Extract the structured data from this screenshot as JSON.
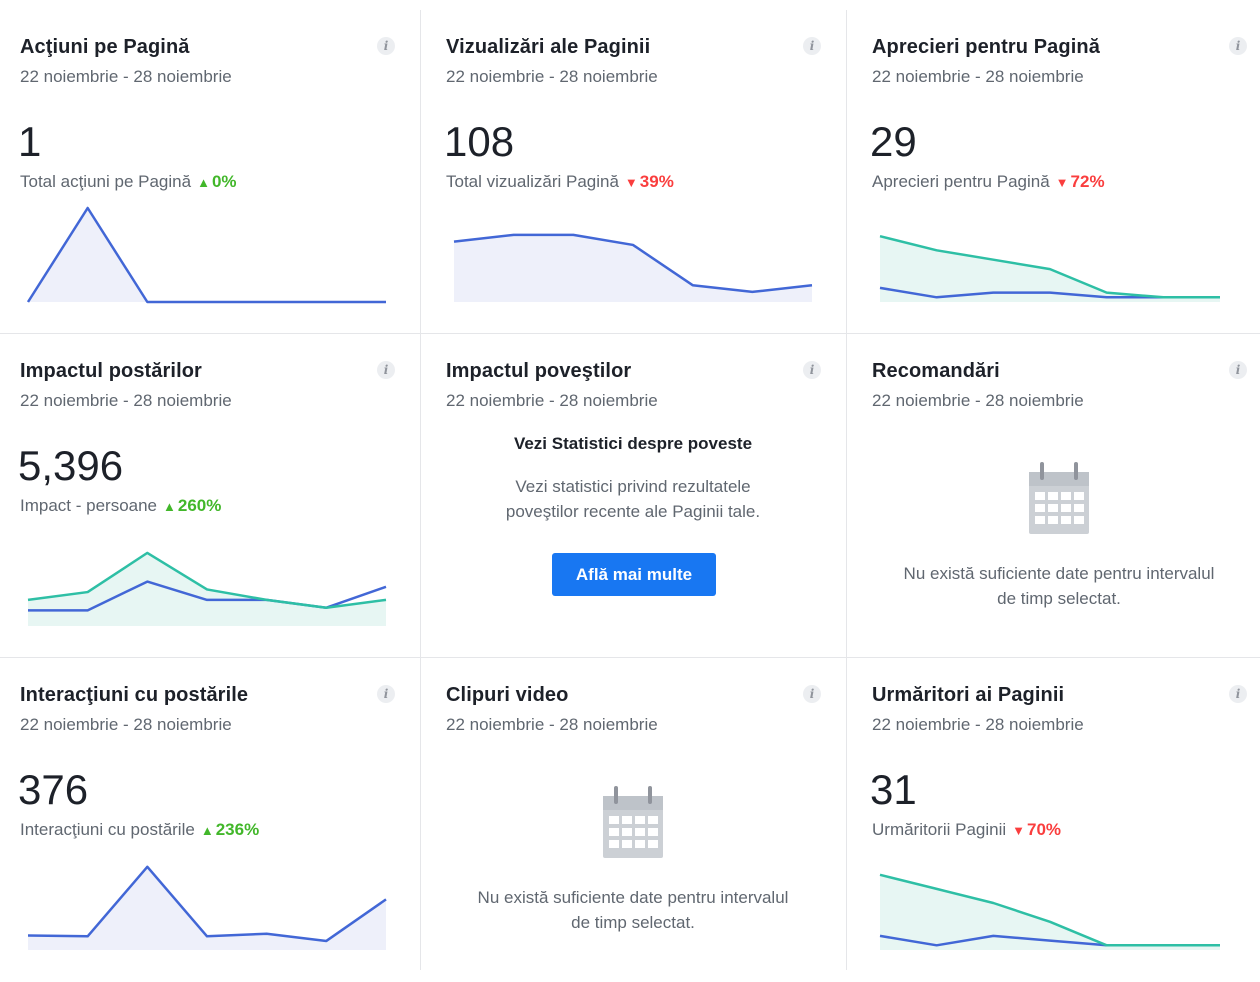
{
  "date_range": "22 noiembrie - 28 noiembrie",
  "colors": {
    "accent_blue": "#4267d6",
    "accent_teal": "#2ebfa5",
    "up": "#42b72a",
    "down": "#fa3e3e",
    "button": "#1877f2"
  },
  "icons": {
    "info": "info-icon",
    "calendar": "calendar-icon"
  },
  "info_glyph": "i",
  "cards": {
    "page_actions": {
      "title": "Acţiuni pe Pagină",
      "value": "1",
      "metric_label": "Total acţiuni pe Pagină",
      "change": "0%",
      "direction": "up",
      "up_glyph": "▲"
    },
    "page_views": {
      "title": "Vizualizări ale Paginii",
      "value": "108",
      "metric_label": "Total vizualizări Pagină",
      "change": "39%",
      "direction": "down",
      "down_glyph": "▼"
    },
    "page_likes": {
      "title": "Aprecieri pentru Pagină",
      "value": "29",
      "metric_label": "Aprecieri pentru Pagină",
      "change": "72%",
      "direction": "down",
      "down_glyph": "▼"
    },
    "post_reach": {
      "title": "Impactul postărilor",
      "value": "5,396",
      "metric_label": "Impact - persoane",
      "change": "260%",
      "direction": "up",
      "up_glyph": "▲"
    },
    "story_reach": {
      "title": "Impactul poveştilor",
      "promo_title": "Vezi Statistici despre poveste",
      "promo_text_line1": "Vezi statistici privind rezultatele",
      "promo_text_line2": "poveştilor recente ale Paginii tale.",
      "button_label": "Află mai multe"
    },
    "recommendations": {
      "title": "Recomandări",
      "empty_line1": "Nu există suficiente date pentru intervalul",
      "empty_line2": "de timp selectat."
    },
    "post_engagement": {
      "title": "Interacţiuni cu postările",
      "value": "376",
      "metric_label": "Interacţiuni cu postările",
      "change": "236%",
      "direction": "up",
      "up_glyph": "▲"
    },
    "videos": {
      "title": "Clipuri video",
      "empty_line1": "Nu există suficiente date pentru intervalul",
      "empty_line2": "de timp selectat."
    },
    "page_followers": {
      "title": "Urmăritori ai Paginii",
      "value": "31",
      "metric_label": "Urmăritorii Paginii",
      "change": "70%",
      "direction": "down",
      "down_glyph": "▼"
    }
  },
  "chart_data": [
    {
      "type": "area",
      "name": "page_actions",
      "series": [
        {
          "values": [
            0,
            1,
            0,
            0,
            0,
            0,
            0
          ]
        }
      ],
      "ylim": [
        0,
        1
      ]
    },
    {
      "type": "area",
      "name": "page_views",
      "series": [
        {
          "values": [
            18,
            20,
            20,
            17,
            5,
            3,
            5
          ]
        }
      ],
      "ylim": [
        0,
        28
      ]
    },
    {
      "type": "area",
      "name": "page_likes",
      "series": [
        {
          "values": [
            3,
            1,
            2,
            2,
            1,
            1,
            1
          ]
        },
        {
          "values": [
            14,
            11,
            9,
            7,
            2,
            1,
            1
          ]
        }
      ],
      "ylim": [
        0,
        20
      ]
    },
    {
      "type": "area",
      "name": "post_reach",
      "series": [
        {
          "values": [
            600,
            600,
            1700,
            1000,
            1000,
            700,
            1500
          ]
        },
        {
          "values": [
            1000,
            1300,
            2800,
            1400,
            1000,
            700,
            1000
          ]
        }
      ],
      "ylim": [
        0,
        3600
      ]
    },
    {
      "type": "area",
      "name": "post_engagement",
      "series": [
        {
          "values": [
            40,
            38,
            230,
            38,
            45,
            25,
            140
          ]
        }
      ],
      "ylim": [
        0,
        260
      ]
    },
    {
      "type": "area",
      "name": "page_followers",
      "series": [
        {
          "values": [
            3,
            1,
            3,
            2,
            1,
            1,
            1
          ]
        },
        {
          "values": [
            16,
            13,
            10,
            6,
            1,
            1,
            1
          ]
        }
      ],
      "ylim": [
        0,
        20
      ]
    }
  ]
}
